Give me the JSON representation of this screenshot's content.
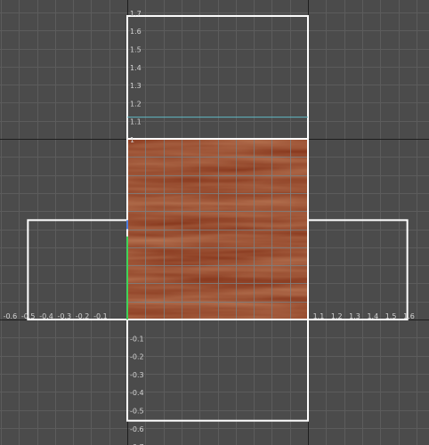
{
  "viewport": {
    "type": "uv-texture-editor",
    "u_range": [
      -0.8,
      1.7
    ],
    "v_range": [
      -0.7,
      1.75
    ],
    "grid_step": 0.1,
    "colors": {
      "background": "#4b4b4b",
      "grid_line": "#5c5c5c",
      "axis_line": "#1e1e1e",
      "label": "#d2d2d2",
      "shell_outline": "#ffffff",
      "texture_grid": "#7f7f7f",
      "teal_edge": "#5fb8c4",
      "green_edge": "#3fd35a",
      "blue_edge": "#4f7fe0",
      "wood_base": "#8a3b20"
    }
  },
  "texture": {
    "name": "wood-texture",
    "u_min": 0,
    "u_max": 1,
    "v_min": 0,
    "v_max": 1
  },
  "uv_shells": [
    {
      "name": "uv-shell-top",
      "u_min": 0,
      "u_max": 1,
      "v_min": 1,
      "v_max": 1.68
    },
    {
      "name": "uv-shell-front",
      "u_min": 0,
      "u_max": 1,
      "v_min": 0,
      "v_max": 1
    },
    {
      "name": "uv-shell-left",
      "u_min": -0.55,
      "u_max": 0,
      "v_min": 0,
      "v_max": 0.55
    },
    {
      "name": "uv-shell-right",
      "u_min": 1,
      "u_max": 1.55,
      "v_min": 0,
      "v_max": 0.55
    },
    {
      "name": "uv-shell-bottom",
      "u_min": 0,
      "u_max": 1,
      "v_min": -0.56,
      "v_max": 0
    }
  ],
  "highlight_edges": [
    {
      "name": "teal-edge",
      "color_key": "teal_edge",
      "u1": 0,
      "v1": 1.12,
      "u2": 1,
      "v2": 1.12
    },
    {
      "name": "green-edge",
      "color_key": "green_edge",
      "u1": 0,
      "v1": 0,
      "u2": 0,
      "v2": 0.46
    },
    {
      "name": "blue-edge",
      "color_key": "blue_edge",
      "u1": 0,
      "v1": 0.5,
      "u2": 0,
      "v2": 0.55
    }
  ],
  "u_labels": [
    "-0.7",
    "-0.6",
    "-0.5",
    "-0.4",
    "-0.3",
    "-0.2",
    "-0.1",
    "1.1",
    "1.2",
    "1.3",
    "1.4",
    "1.5",
    "1.6"
  ],
  "v_labels": [
    "1.7",
    "1.6",
    "1.5",
    "1.4",
    "1.3",
    "1.2",
    "1.1",
    "1",
    "-0.1",
    "-0.2",
    "-0.3",
    "-0.4",
    "-0.5",
    "-0.6",
    "-0.7"
  ]
}
